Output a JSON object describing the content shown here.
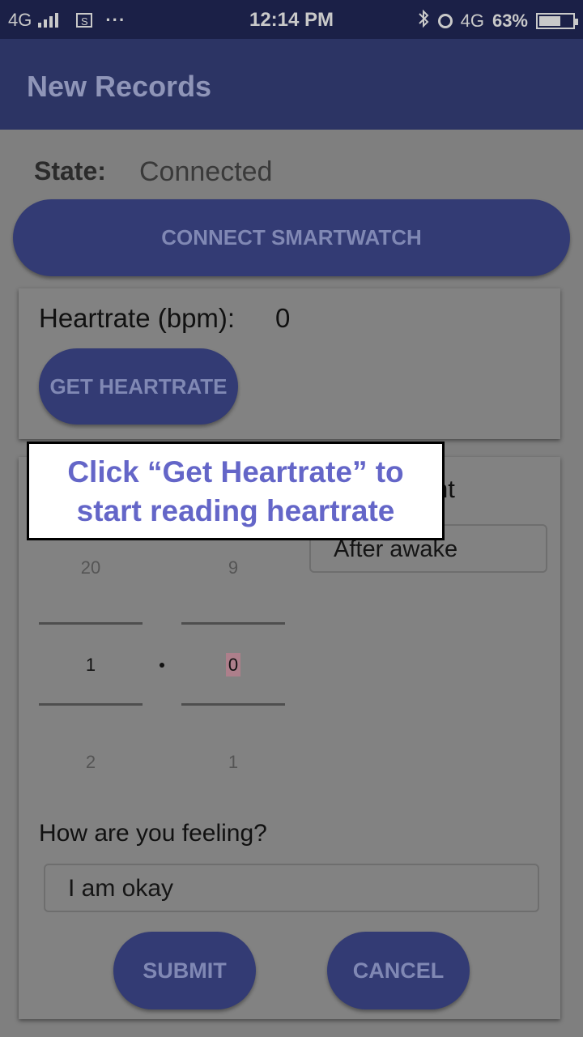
{
  "status_bar": {
    "network_left": "4G",
    "time": "12:14 PM",
    "network_right": "4G",
    "battery_percent": "63%",
    "dots": "···",
    "s_icon_label": "S"
  },
  "app_bar": {
    "title": "New Records"
  },
  "state": {
    "label": "State:",
    "value": "Connected"
  },
  "connect_button": {
    "label": "CONNECT SMARTWATCH"
  },
  "heartrate": {
    "label": "Heartrate (bpm):",
    "value": "0",
    "button_label": "GET HEARTRATE"
  },
  "measurement": {
    "label_partial": "nt",
    "time_value": "After awake"
  },
  "picker": {
    "left": {
      "above": "20",
      "selected": "1",
      "below": "2"
    },
    "right": {
      "above": "9",
      "selected": "0",
      "below": "1"
    },
    "separator": "·"
  },
  "feeling": {
    "label": "How are you feeling?",
    "value": "I am okay"
  },
  "actions": {
    "submit_label": "SUBMIT",
    "cancel_label": "CANCEL"
  },
  "tutorial": {
    "line1": "Click “Get Heartrate” to",
    "line2": "start reading heartrate"
  }
}
